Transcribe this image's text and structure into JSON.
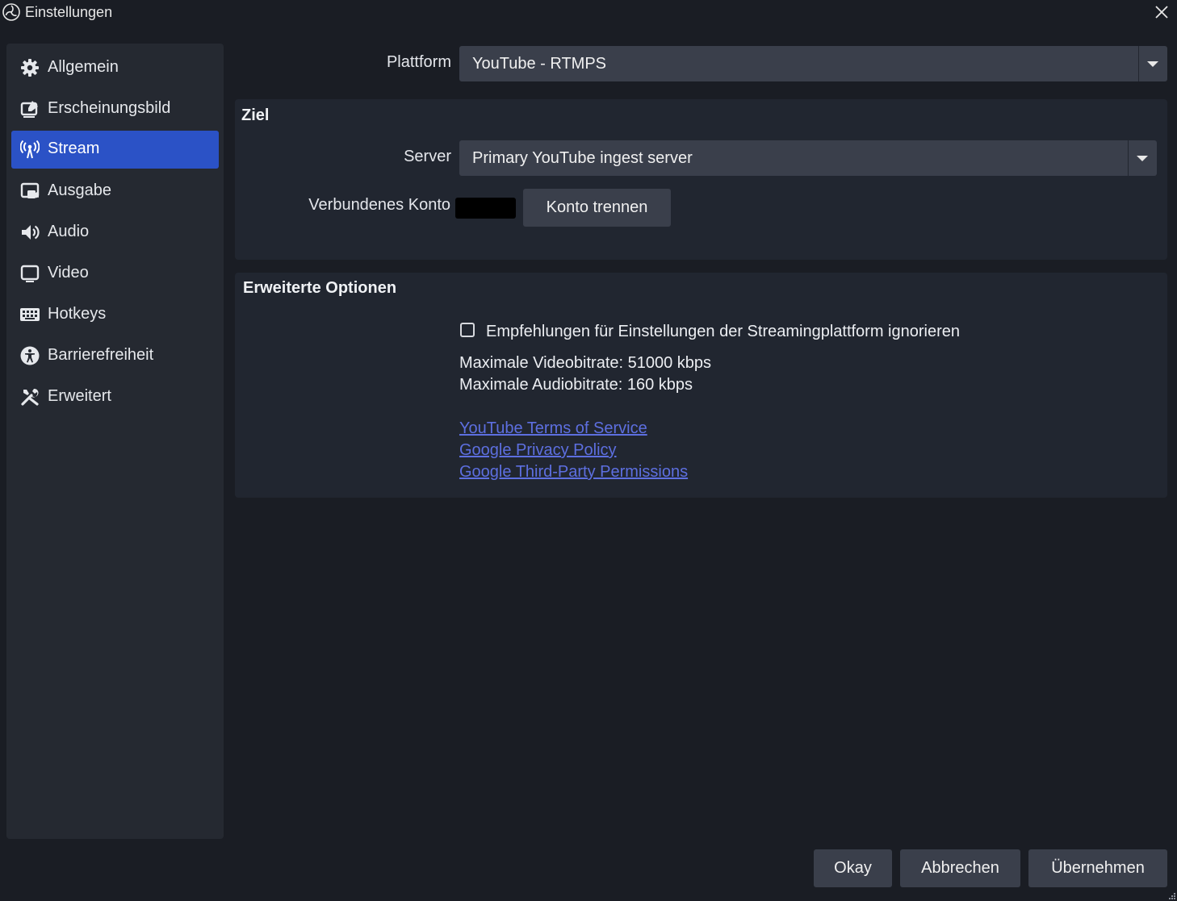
{
  "window": {
    "title": "Einstellungen",
    "icon": "obs-logo-icon",
    "close_icon": "close-icon"
  },
  "sidebar": {
    "active_index": 2,
    "items": [
      {
        "label": "Allgemein",
        "icon": "gear-icon"
      },
      {
        "label": "Erscheinungsbild",
        "icon": "appearance-icon"
      },
      {
        "label": "Stream",
        "icon": "antenna-icon"
      },
      {
        "label": "Ausgabe",
        "icon": "output-icon"
      },
      {
        "label": "Audio",
        "icon": "speaker-icon"
      },
      {
        "label": "Video",
        "icon": "monitor-icon"
      },
      {
        "label": "Hotkeys",
        "icon": "keyboard-icon"
      },
      {
        "label": "Barrierefreiheit",
        "icon": "accessibility-icon"
      },
      {
        "label": "Erweitert",
        "icon": "tools-icon"
      }
    ]
  },
  "stream": {
    "platform_label": "Plattform",
    "platform_value": "YouTube - RTMPS",
    "destination": {
      "title": "Ziel",
      "server_label": "Server",
      "server_value": "Primary YouTube ingest server",
      "account_label": "Verbundenes Konto",
      "disconnect_button": "Konto trennen"
    },
    "advanced": {
      "title": "Erweiterte Optionen",
      "ignore_recommendations_label": "Empfehlungen für Einstellungen der Streamingplattform ignorieren",
      "ignore_recommendations_checked": false,
      "max_video_bitrate": "Maximale Videobitrate: 51000 kbps",
      "max_audio_bitrate": "Maximale Audiobitrate: 160 kbps",
      "links": [
        "YouTube Terms of Service",
        "Google Privacy Policy",
        "Google Third-Party Permissions"
      ]
    }
  },
  "footer": {
    "ok_button": "Okay",
    "cancel_button": "Abbrechen",
    "apply_button": "Übernehmen"
  },
  "colors": {
    "background": "#1a1d24",
    "sidebar_bg": "#252931",
    "panel_bg": "#212630",
    "control_bg": "#3a3f4b",
    "accent": "#2b52c6",
    "link": "#5d6fe0"
  }
}
